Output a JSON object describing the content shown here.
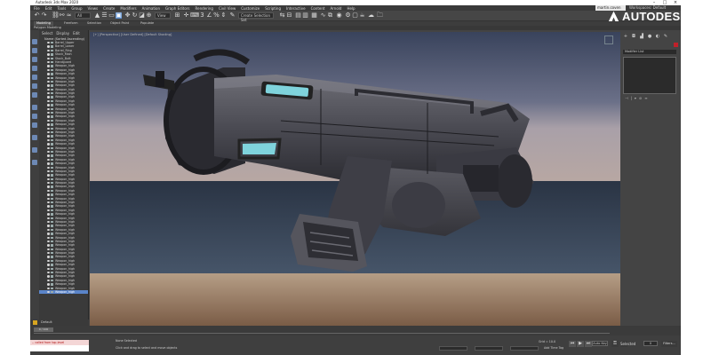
{
  "window": {
    "title": "Autodesk 3ds Max 2020"
  },
  "menu": {
    "items": [
      "File",
      "Edit",
      "Tools",
      "Group",
      "Views",
      "Create",
      "Modifiers",
      "Animation",
      "Graph Editors",
      "Rendering",
      "Civil View",
      "Customize",
      "Scripting",
      "Interactive",
      "Content",
      "Arnold",
      "Help"
    ],
    "user": "martin.coven",
    "workspace": "Workspaces: Default"
  },
  "toolbar": {
    "filter": "All",
    "view": "View",
    "selection_set": "Create Selection Set"
  },
  "ribbon": {
    "tabs": [
      "Modeling",
      "Freeform",
      "Selection",
      "Object Paint",
      "Populate"
    ],
    "active_tab": "Modeling",
    "sub_label": "Polygon Modeling"
  },
  "brand": {
    "name": "AUTODESK."
  },
  "explorer": {
    "tabs": [
      "Select",
      "Display",
      "Edit"
    ],
    "root": "Name (Sorted Ascending)",
    "objects": [
      "Barrel_Upper",
      "Barrel_Lower",
      "Barrel_Ring",
      "Stock_Main",
      "Stock_Butt",
      "Handguard",
      "Weapon_high",
      "Weapon_high",
      "Weapon_high",
      "Weapon_high",
      "Weapon_high",
      "Weapon_high",
      "Weapon_high",
      "Weapon_high",
      "Weapon_high",
      "Weapon_high",
      "Weapon_high",
      "Weapon_high",
      "Weapon_high",
      "Weapon_high",
      "Weapon_high",
      "Weapon_high",
      "Weapon_high",
      "Weapon_high",
      "Weapon_high",
      "Weapon_high",
      "Weapon_high",
      "Weapon_high",
      "Weapon_high",
      "Weapon_high",
      "Weapon_high",
      "Weapon_high",
      "Weapon_high",
      "Weapon_high",
      "Weapon_high",
      "Weapon_high",
      "Weapon_high",
      "Weapon_high",
      "Weapon_high",
      "Weapon_high",
      "Weapon_high",
      "Weapon_high",
      "Weapon_high",
      "Weapon_high",
      "Weapon_high",
      "Weapon_high",
      "Weapon_high",
      "Weapon_high",
      "Weapon_high",
      "Weapon_high",
      "Weapon_high",
      "Weapon_high",
      "Weapon_high",
      "Weapon_high",
      "Weapon_high",
      "Weapon_high",
      "Weapon_high",
      "Weapon_high",
      "Weapon_high",
      "Weapon_high",
      "Weapon_high",
      "Weapon_high",
      "Weapon_high",
      "Weapon_high",
      "Weapon_high"
    ],
    "selected_object": "Weapon_high"
  },
  "viewport": {
    "label": "[+] [Perspective] [User Defined] [Default Shading]"
  },
  "command_panel": {
    "modifier_list": "Modifier List"
  },
  "layer": {
    "name": "Default"
  },
  "timeline": {
    "current": "0 / 100"
  },
  "status": {
    "selection": "None Selected",
    "prompt": "Click and drag to select and move objects",
    "maxscript_error": "-- called from top-level",
    "grid": "Grid = 10.0",
    "add_time_tag": "Add Time Tag",
    "auto_key": "Auto Key",
    "set_key": "Set Key",
    "frame": "0",
    "selected": "Selected",
    "filters": "Filters..."
  }
}
